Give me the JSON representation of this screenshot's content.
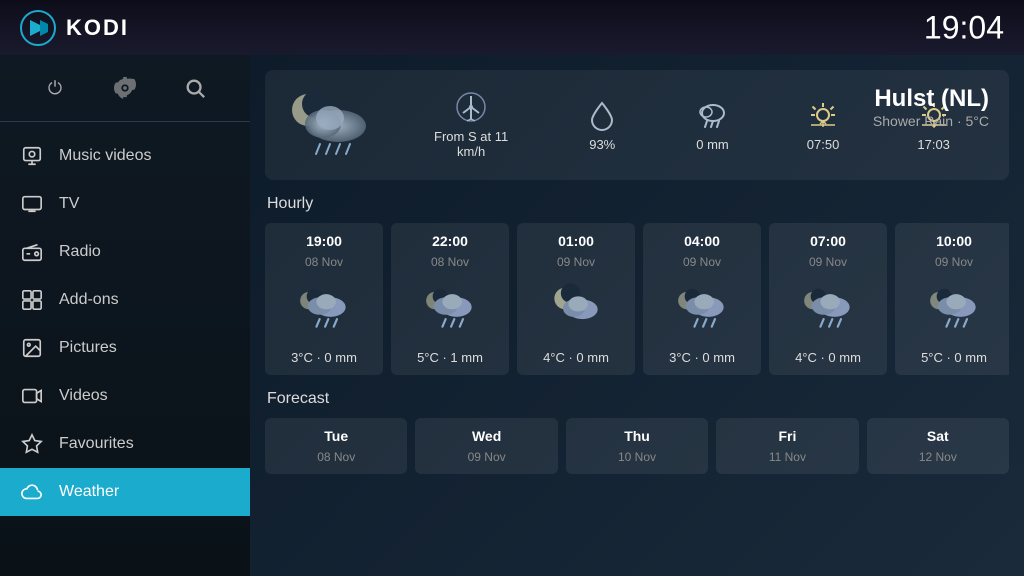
{
  "header": {
    "app_name": "KODI",
    "clock": "19:04"
  },
  "sidebar": {
    "icon_buttons": [
      {
        "name": "power-icon",
        "symbol": "⏻"
      },
      {
        "name": "settings-icon",
        "symbol": "⚙"
      },
      {
        "name": "search-icon",
        "symbol": "🔍"
      }
    ],
    "nav_items": [
      {
        "id": "music-videos",
        "label": "Music videos",
        "icon": "🎬"
      },
      {
        "id": "tv",
        "label": "TV",
        "icon": "📺"
      },
      {
        "id": "radio",
        "label": "Radio",
        "icon": "📻"
      },
      {
        "id": "add-ons",
        "label": "Add-ons",
        "icon": "🎁"
      },
      {
        "id": "pictures",
        "label": "Pictures",
        "icon": "🖼"
      },
      {
        "id": "videos",
        "label": "Videos",
        "icon": "🎞"
      },
      {
        "id": "favourites",
        "label": "Favourites",
        "icon": "⭐"
      },
      {
        "id": "weather",
        "label": "Weather",
        "icon": "🌤",
        "active": true
      }
    ]
  },
  "current_weather": {
    "location": "Hulst (NL)",
    "description": "Shower Rain · 5°C",
    "stats": [
      {
        "icon": "wind",
        "value": "From S at 11\nkm/h"
      },
      {
        "icon": "humidity",
        "value": "93%"
      },
      {
        "icon": "rain",
        "value": "0 mm"
      },
      {
        "icon": "sunrise",
        "value": "07:50"
      },
      {
        "icon": "sunset",
        "value": "17:03"
      }
    ]
  },
  "hourly_title": "Hourly",
  "hourly": [
    {
      "time": "19:00",
      "date": "08 Nov",
      "icon": "cloud-rain",
      "temp": "3°C · 0 mm"
    },
    {
      "time": "22:00",
      "date": "08 Nov",
      "icon": "cloud-rain",
      "temp": "5°C · 1 mm"
    },
    {
      "time": "01:00",
      "date": "09 Nov",
      "icon": "moon-cloud",
      "temp": "4°C · 0 mm"
    },
    {
      "time": "04:00",
      "date": "09 Nov",
      "icon": "cloud-rain",
      "temp": "3°C · 0 mm"
    },
    {
      "time": "07:00",
      "date": "09 Nov",
      "icon": "cloud-rain",
      "temp": "4°C · 0 mm"
    },
    {
      "time": "10:00",
      "date": "09 Nov",
      "icon": "cloud",
      "temp": "5°C · 0 mm"
    }
  ],
  "forecast_title": "Forecast",
  "forecast": [
    {
      "day": "Tue",
      "date": "08 Nov"
    },
    {
      "day": "Wed",
      "date": "09 Nov"
    },
    {
      "day": "Thu",
      "date": "10 Nov"
    },
    {
      "day": "Fri",
      "date": "11 Nov"
    },
    {
      "day": "Sat",
      "date": "12 Nov"
    }
  ]
}
